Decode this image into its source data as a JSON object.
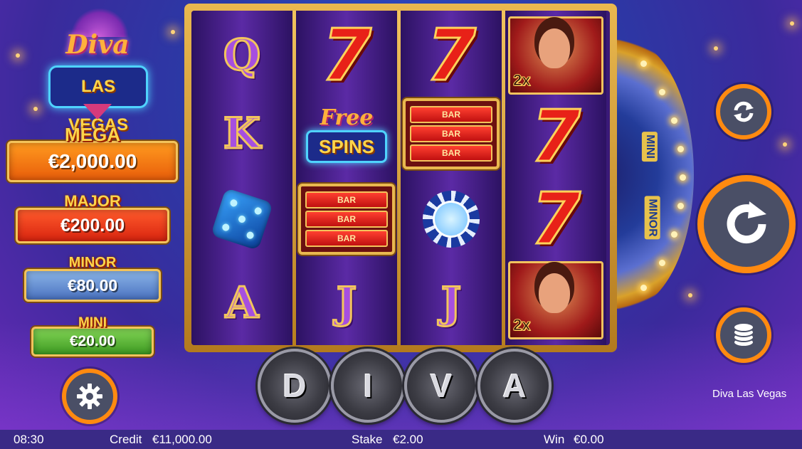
{
  "logo": {
    "line1": "Diva",
    "line2": "LAS VEGAS"
  },
  "jackpots": [
    {
      "title": "MEGA",
      "amount": "€2,000.00"
    },
    {
      "title": "MAJOR",
      "amount": "€200.00"
    },
    {
      "title": "MINOR",
      "amount": "€80.00"
    },
    {
      "title": "MINI",
      "amount": "€20.00"
    }
  ],
  "reels": {
    "reel1": [
      "Q",
      "K",
      "dice",
      "A"
    ],
    "reel2": [
      "7",
      "FREE SPINS",
      "BAR BAR BAR",
      "J"
    ],
    "reel3": [
      "7",
      "BAR BAR BAR",
      "chip",
      "J"
    ],
    "reel4": [
      "diva 2x",
      "7",
      "7",
      "diva 2x"
    ],
    "bar_label": "BAR",
    "free_word": "Free",
    "spins_word": "SPINS",
    "multiplier": "2x"
  },
  "wheel": {
    "segments": [
      "MINI",
      "MINOR"
    ]
  },
  "diva_letters": [
    "D",
    "I",
    "V",
    "A"
  ],
  "game_name": "Diva Las Vegas",
  "status": {
    "time": "08:30",
    "credit_label": "Credit",
    "credit_value": "€11,000.00",
    "stake_label": "Stake",
    "stake_value": "€2.00",
    "win_label": "Win",
    "win_value": "€0.00"
  },
  "colors": {
    "accent": "#ff8a10",
    "gold": "#f1c35e",
    "status_bar": "#3a2a86"
  }
}
